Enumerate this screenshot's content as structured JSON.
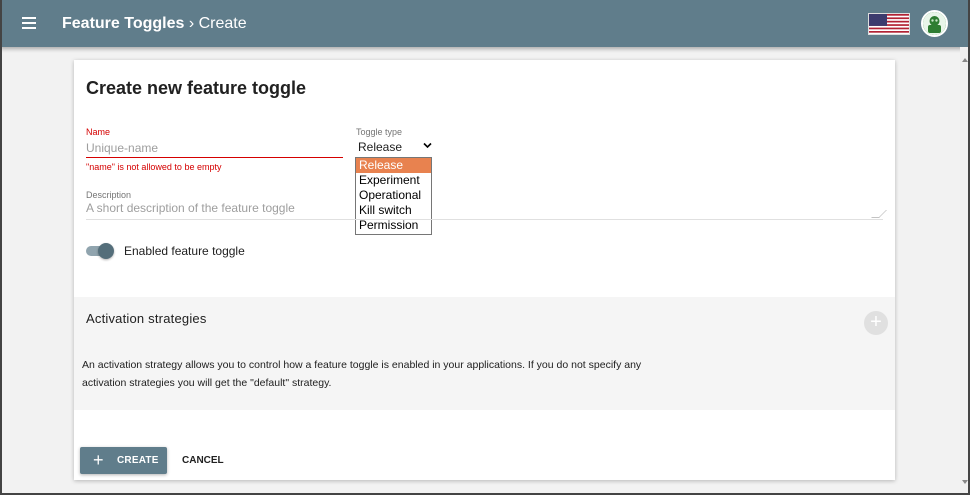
{
  "appbar": {
    "title": "Feature Toggles",
    "separator": "›",
    "current": "Create"
  },
  "icons": {
    "menu": "hamburger-menu-icon",
    "flag": "us-flag-icon",
    "avatar": "user-avatar-icon",
    "add": "plus-icon"
  },
  "colors": {
    "primary": "#607d8b",
    "error": "#d50000",
    "selected_option": "#e8824f"
  },
  "form": {
    "title": "Create new feature toggle",
    "name": {
      "label": "Name",
      "value": "",
      "placeholder": "Unique-name",
      "error": "\"name\" is not allowed to be empty"
    },
    "toggle_type": {
      "label": "Toggle type",
      "selected": "Release",
      "options": [
        "Release",
        "Experiment",
        "Operational",
        "Kill switch",
        "Permission"
      ]
    },
    "description": {
      "label": "Description",
      "value": "",
      "placeholder": "A short description of the feature toggle"
    },
    "enabled": {
      "label": "Enabled feature toggle",
      "checked": true
    }
  },
  "activation": {
    "title": "Activation strategies",
    "description": "An activation strategy allows you to control how a feature toggle is enabled in your applications. If you do not specify any activation strategies you will get the \"default\" strategy."
  },
  "actions": {
    "create_icon": "+",
    "create": "CREATE",
    "cancel": "CANCEL"
  }
}
